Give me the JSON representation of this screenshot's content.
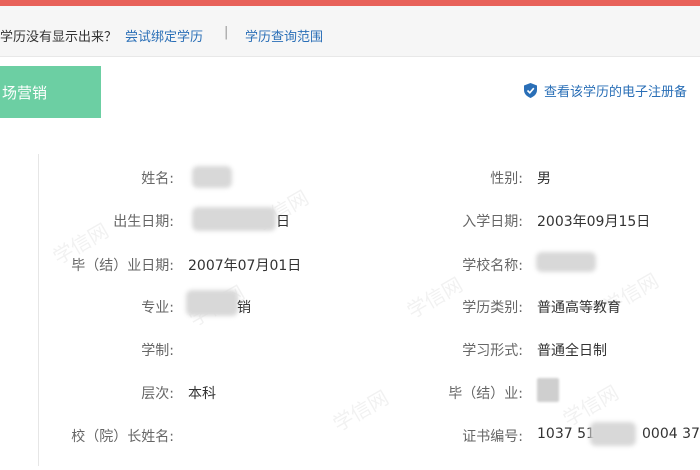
{
  "notice": {
    "text": "学历没有显示出来？",
    "bind_link": "尝试绑定学历",
    "separator": "|",
    "range_link": "学历查询范围"
  },
  "tab": {
    "label": "场营销"
  },
  "verify_link": {
    "label": "查看该学历的电子注册备"
  },
  "fields": {
    "name": {
      "label": "姓名:",
      "value": ""
    },
    "gender": {
      "label": "性别:",
      "value": "男"
    },
    "birth_date": {
      "label": "出生日期:",
      "value": "日"
    },
    "enroll_date": {
      "label": "入学日期:",
      "value": "2003年09月15日"
    },
    "graduation_date": {
      "label": "毕（结）业日期:",
      "value": "2007年07月01日"
    },
    "school_name": {
      "label": "学校名称:",
      "value": ""
    },
    "major": {
      "label": "专业:",
      "value": "销"
    },
    "education_type": {
      "label": "学历类别:",
      "value": "普通高等教育"
    },
    "duration": {
      "label": "学制:",
      "value": ""
    },
    "study_mode": {
      "label": "学习形式:",
      "value": "普通全日制"
    },
    "level": {
      "label": "层次:",
      "value": "本科"
    },
    "completion": {
      "label": "毕（结）业:",
      "value": ""
    },
    "principal": {
      "label": "校（院）长姓名:",
      "value": ""
    },
    "certificate_no": {
      "label": "证书编号:",
      "value_prefix": "1037 51",
      "value_suffix": "0004 37"
    }
  },
  "watermark": "学信网",
  "colors": {
    "accent_red": "#e8625a",
    "link_blue": "#2a6fb7",
    "tab_green": "#6ccfa3"
  }
}
